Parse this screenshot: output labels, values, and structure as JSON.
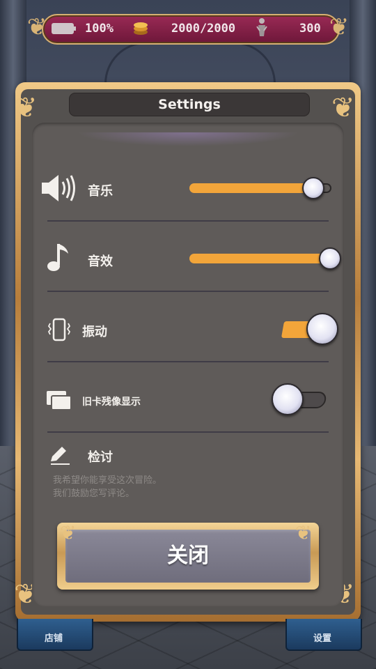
{
  "status_bar": {
    "battery": "100%",
    "coins": "2000/2000",
    "figures": "300"
  },
  "dialog": {
    "title": "Settings",
    "music": {
      "label": "音乐",
      "value": 0.88
    },
    "sound_effects": {
      "label": "音效",
      "value": 1.0
    },
    "vibration": {
      "label": "振动",
      "enabled": true
    },
    "old_card_afterimage": {
      "label": "旧卡残像显示",
      "enabled": false
    },
    "review": {
      "label": "检讨",
      "line1": "我希望你能享受这次冒险。",
      "line2": "我们鼓励您写评论。"
    },
    "close_label": "关闭"
  },
  "bottom_nav": {
    "shop_label": "店铺",
    "settings_label": "设置"
  },
  "colors": {
    "accent": "#f2a53a",
    "panel": "#54514f",
    "gold": "#d9b476",
    "topbar": "#8a2149"
  }
}
